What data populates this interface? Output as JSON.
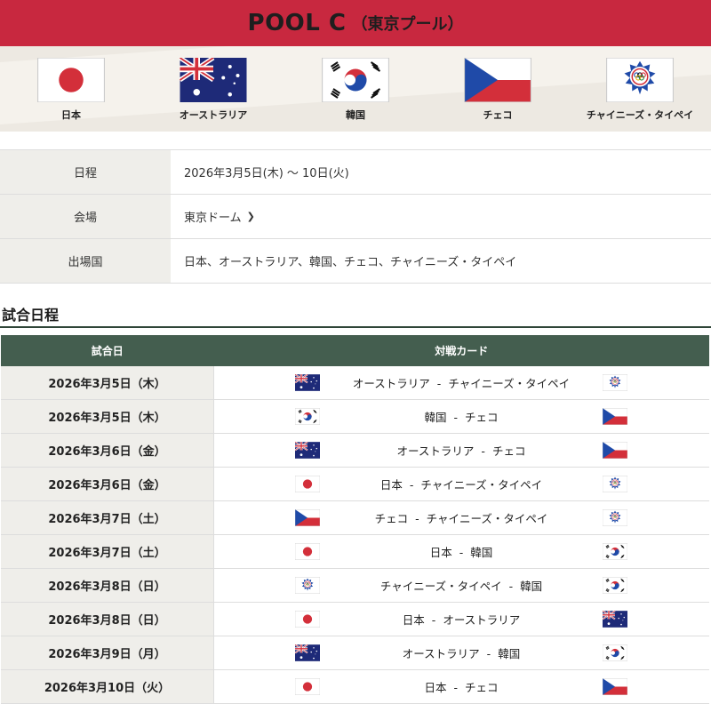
{
  "header": {
    "title": "POOL C",
    "subtitle": "（東京プール）"
  },
  "teams": [
    {
      "name": "日本",
      "flag": "japan-flag"
    },
    {
      "name": "オーストラリア",
      "flag": "australia-flag"
    },
    {
      "name": "韓国",
      "flag": "korea-flag"
    },
    {
      "name": "チェコ",
      "flag": "czech-flag"
    },
    {
      "name": "チャイニーズ・タイペイ",
      "flag": "chinese-taipei-flag"
    }
  ],
  "info": {
    "dates_label": "日程",
    "dates_value": "2026年3月5日(木) 〜 10日(火)",
    "venue_label": "会場",
    "venue_value": "東京ドーム",
    "countries_label": "出場国",
    "countries_value": "日本、オーストラリア、韓国、チェコ、チャイニーズ・タイペイ"
  },
  "schedule": {
    "title": "試合日程",
    "col_date": "試合日",
    "col_match": "対戦カード",
    "separator": "-",
    "rows": [
      {
        "date": "2026年3月5日（木）",
        "home": "オーストラリア",
        "away": "チャイニーズ・タイペイ",
        "home_flag": "australia",
        "away_flag": "taipei"
      },
      {
        "date": "2026年3月5日（木）",
        "home": "韓国",
        "away": "チェコ",
        "home_flag": "korea",
        "away_flag": "czech"
      },
      {
        "date": "2026年3月6日（金）",
        "home": "オーストラリア",
        "away": "チェコ",
        "home_flag": "australia",
        "away_flag": "czech"
      },
      {
        "date": "2026年3月6日（金）",
        "home": "日本",
        "away": "チャイニーズ・タイペイ",
        "home_flag": "japan",
        "away_flag": "taipei"
      },
      {
        "date": "2026年3月7日（土）",
        "home": "チェコ",
        "away": "チャイニーズ・タイペイ",
        "home_flag": "czech",
        "away_flag": "taipei"
      },
      {
        "date": "2026年3月7日（土）",
        "home": "日本",
        "away": "韓国",
        "home_flag": "japan",
        "away_flag": "korea"
      },
      {
        "date": "2026年3月8日（日）",
        "home": "チャイニーズ・タイペイ",
        "away": "韓国",
        "home_flag": "taipei",
        "away_flag": "korea"
      },
      {
        "date": "2026年3月8日（日）",
        "home": "日本",
        "away": "オーストラリア",
        "home_flag": "japan",
        "away_flag": "australia"
      },
      {
        "date": "2026年3月9日（月）",
        "home": "オーストラリア",
        "away": "韓国",
        "home_flag": "australia",
        "away_flag": "korea"
      },
      {
        "date": "2026年3月10日（火）",
        "home": "日本",
        "away": "チェコ",
        "home_flag": "japan",
        "away_flag": "czech"
      }
    ]
  },
  "colors": {
    "header_red": "#c8283f",
    "table_header_green": "#445e4f",
    "label_bg": "#efeeea"
  }
}
